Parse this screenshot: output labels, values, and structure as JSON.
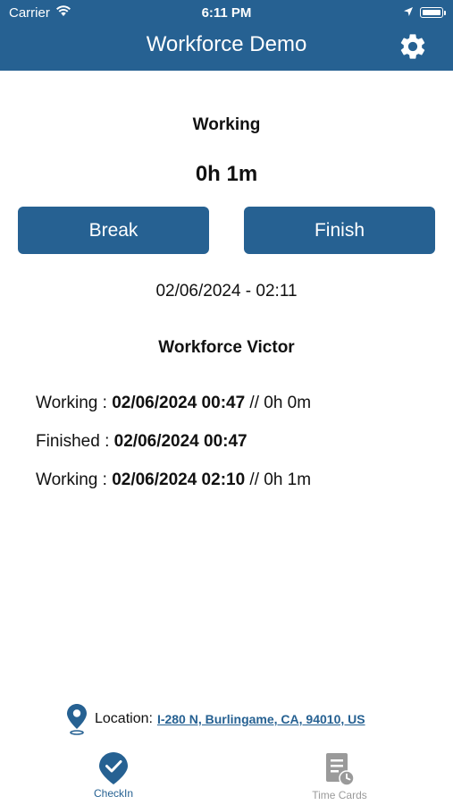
{
  "status_bar": {
    "carrier": "Carrier",
    "time": "6:11 PM"
  },
  "nav": {
    "title": "Workforce Demo"
  },
  "session": {
    "state": "Working",
    "duration": "0h 1m",
    "break_label": "Break",
    "finish_label": "Finish",
    "current_datetime": "02/06/2024 - 02:11",
    "user_name": "Workforce Victor"
  },
  "log": [
    {
      "label": "Working : ",
      "timestamp": "02/06/2024 00:47",
      "duration": " // 0h 0m"
    },
    {
      "label": "Finished : ",
      "timestamp": "02/06/2024 00:47",
      "duration": ""
    },
    {
      "label": "Working : ",
      "timestamp": "02/06/2024 02:10",
      "duration": " // 0h 1m"
    }
  ],
  "location": {
    "label": "Location:",
    "address": "I-280 N, Burlingame, CA, 94010, US"
  },
  "tabs": [
    {
      "label": "CheckIn",
      "icon": "checkin-icon",
      "active": true
    },
    {
      "label": "Time Cards",
      "icon": "time-cards-icon",
      "active": false
    }
  ],
  "colors": {
    "primary": "#266192",
    "inactive": "#9a9a9a"
  }
}
